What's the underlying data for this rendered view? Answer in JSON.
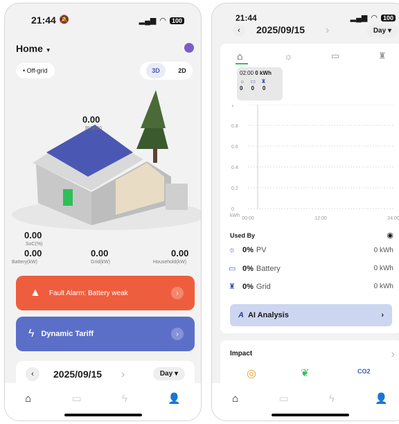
{
  "status": {
    "time": "21:44",
    "battery": "100"
  },
  "left": {
    "home_title": "Home",
    "mode_pill": "• Off-grid",
    "view_3d": "3D",
    "view_2d": "2D",
    "pv_value": "0.00",
    "pv_label": "PV(kW)",
    "soc_value": "0.00",
    "soc_label": "SoC(%)",
    "battery_value": "0.00",
    "battery_label": "Battery(kW)",
    "grid_value": "0.00",
    "grid_label": "Grid(kW)",
    "household_value": "0.00",
    "household_label": "Household(kW)",
    "fault_text": "Fault Alarm: Battery weak",
    "tariff_text": "Dynamic Tariff",
    "date": "2025/09/15",
    "period": "Day"
  },
  "right": {
    "date": "2025/09/15",
    "period": "Day",
    "tooltip_time": "02:00",
    "tooltip_value": "0 kWh",
    "tooltip_nums": [
      "0",
      "0",
      "0"
    ],
    "chart_data": {
      "type": "line",
      "ylabel": "kWh",
      "yticks": [
        "1",
        "0.8",
        "0.6",
        "0.4",
        "0.2",
        "0"
      ],
      "xticks": [
        "00:00",
        "12:00",
        "24:00"
      ],
      "ylim": [
        0,
        1
      ]
    },
    "used_by_title": "Used By",
    "rows": [
      {
        "pct": "0%",
        "name": "PV",
        "kwh": "0 kWh"
      },
      {
        "pct": "0%",
        "name": "Battery",
        "kwh": "0 kWh"
      },
      {
        "pct": "0%",
        "name": "Grid",
        "kwh": "0 kWh"
      }
    ],
    "ai_label": "AI Analysis",
    "impact_title": "Impact",
    "co2_label": "CO2"
  }
}
